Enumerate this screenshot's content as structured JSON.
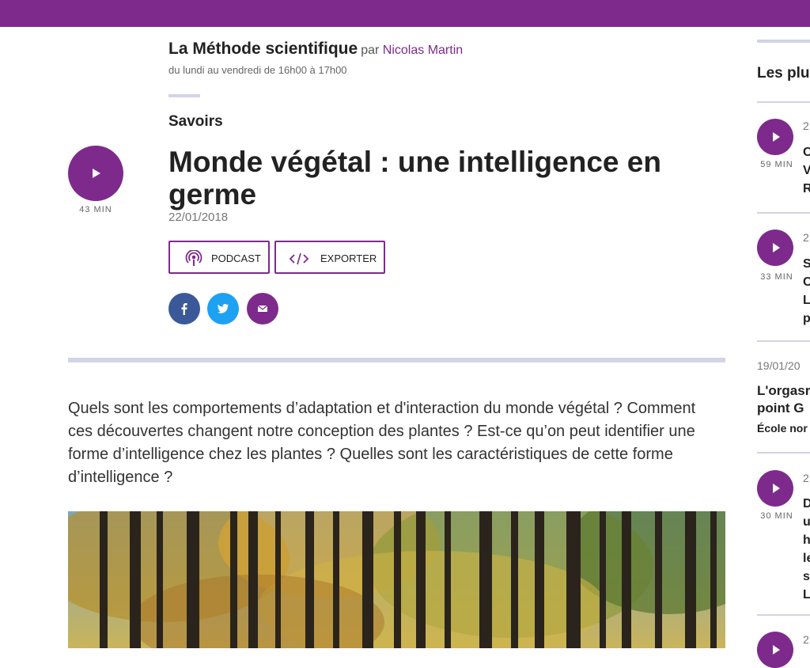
{
  "show": {
    "title": "La Méthode scientifique",
    "par": "par",
    "author": "Nicolas Martin",
    "schedule": "du lundi au vendredi de 16h00 à 17h00"
  },
  "episode": {
    "category": "Savoirs",
    "title": "Monde végétal : une intelligence en germe",
    "date": "22/01/2018",
    "duration": "43 MIN",
    "intro": "Quels sont les comportements d’adaptation et d'interaction du monde végétal ? Comment ces découvertes changent notre conception des plantes ? Est-ce qu’on peut identifier une forme d’intelligence chez les plantes ? Quelles sont les caractéristiques de cette forme d’intelligence ?"
  },
  "actions": {
    "podcast_label": "PODCAST",
    "exporter_label": "EXPORTER"
  },
  "social": {
    "facebook_icon": "facebook-icon",
    "twitter_icon": "twitter-icon",
    "mail_icon": "mail-icon"
  },
  "sidebar": {
    "heading": "Les plu",
    "items": [
      {
        "date": "2",
        "duration": "59 MIN",
        "lines": "C\nV\nR"
      },
      {
        "date": "2",
        "duration": "33 MIN",
        "lines": "S\nC\nL\np"
      },
      {
        "date": "19/01/20",
        "title_line1": "L'orgasr",
        "title_line2": "point G",
        "source": "École nor"
      },
      {
        "date": "2",
        "duration": "30 MIN",
        "lines": "D\nu\nh\nle\ns\nL"
      },
      {
        "date": "2"
      }
    ]
  },
  "colors": {
    "accent": "#7e2a8c",
    "separator": "#d2d4e4",
    "facebook": "#3b5998",
    "twitter": "#1da1f2"
  }
}
